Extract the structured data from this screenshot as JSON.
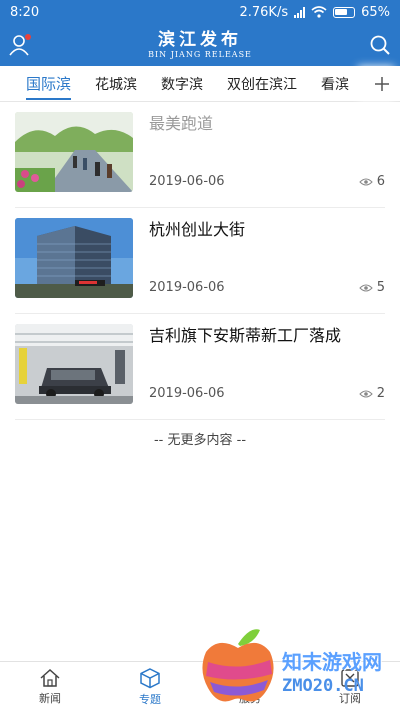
{
  "status_bar": {
    "time": "8:20",
    "network_speed": "2.76K/s",
    "battery": "65%"
  },
  "header": {
    "brand_cn": "滨江发布",
    "brand_en": "BIN JIANG RELEASE"
  },
  "tabs": [
    {
      "label": "国际滨",
      "active": true
    },
    {
      "label": "花城滨",
      "active": false
    },
    {
      "label": "数字滨",
      "active": false
    },
    {
      "label": "双创在滨江",
      "active": false
    },
    {
      "label": "看滨",
      "active": false
    }
  ],
  "news": [
    {
      "title": "最美跑道",
      "date": "2019-06-06",
      "views": "6",
      "read": true
    },
    {
      "title": "杭州创业大街",
      "date": "2019-06-06",
      "views": "5",
      "read": false
    },
    {
      "title": "吉利旗下安斯蒂新工厂落成",
      "date": "2019-06-06",
      "views": "2",
      "read": false
    }
  ],
  "no_more_text": "-- 无更多内容 --",
  "bottom_nav": [
    {
      "label": "新闻",
      "icon": "home-icon",
      "active": false
    },
    {
      "label": "专题",
      "icon": "cube-icon",
      "active": true
    },
    {
      "label": "服务",
      "icon": "grid-icon",
      "active": false
    },
    {
      "label": "订阅",
      "icon": "subscribe-icon",
      "active": false
    }
  ],
  "watermark": {
    "line1": "知末游戏网",
    "line2": "ZMO20.CN"
  },
  "colors": {
    "primary": "#2b78c9",
    "text": "#111111",
    "muted": "#9a9a9a"
  }
}
